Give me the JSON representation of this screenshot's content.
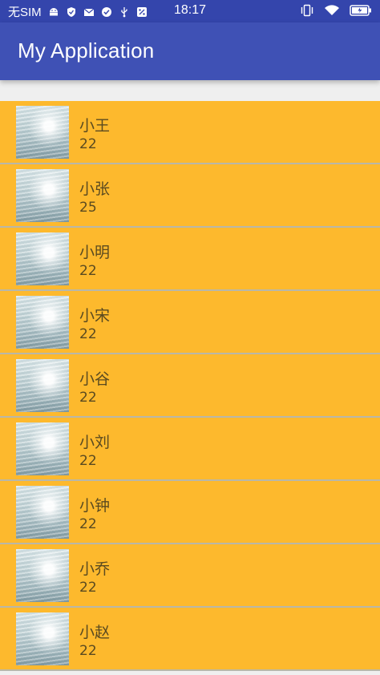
{
  "status_bar": {
    "carrier": "无SIM",
    "time": "18:17",
    "icons_left": [
      "android-icon",
      "shield-icon",
      "mail-icon",
      "check-circle-icon",
      "usb-icon",
      "percent-icon"
    ],
    "icons_right": [
      "vibrate-icon",
      "wifi-icon",
      "battery-icon"
    ]
  },
  "app_bar": {
    "title": "My Application",
    "color": "#3f51b5"
  },
  "list": {
    "background": "#fdb92d",
    "items": [
      {
        "name": "小王",
        "age": "22"
      },
      {
        "name": "小张",
        "age": "25"
      },
      {
        "name": "小明",
        "age": "22"
      },
      {
        "name": "小宋",
        "age": "22"
      },
      {
        "name": "小谷",
        "age": "22"
      },
      {
        "name": "小刘",
        "age": "22"
      },
      {
        "name": "小钟",
        "age": "22"
      },
      {
        "name": "小乔",
        "age": "22"
      },
      {
        "name": "小赵",
        "age": "22"
      }
    ]
  }
}
